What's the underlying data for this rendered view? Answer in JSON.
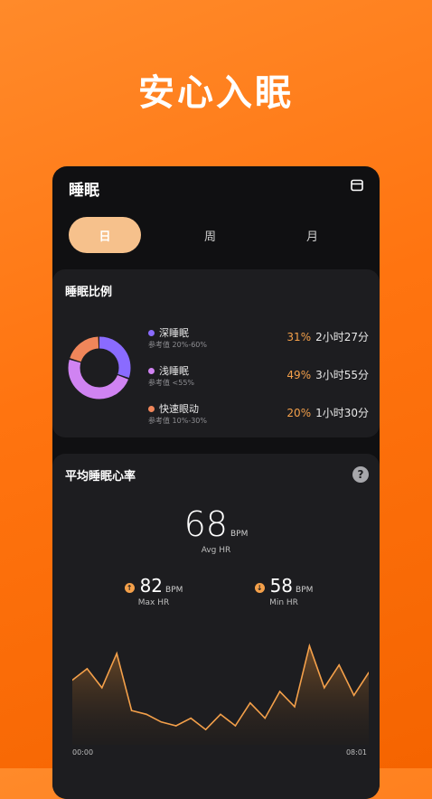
{
  "headline": "安心入眠",
  "header": {
    "title": "睡眠"
  },
  "tabs": [
    {
      "label": "日"
    },
    {
      "label": "周"
    },
    {
      "label": "月"
    }
  ],
  "ratio_card": {
    "title": "睡眠比例",
    "items": [
      {
        "name": "深睡眠",
        "ref": "参考值 20%-60%",
        "percent": "31%",
        "duration": "2小时27分",
        "color": "#8a6bff",
        "value": 31
      },
      {
        "name": "浅睡眠",
        "ref": "参考值 <55%",
        "percent": "49%",
        "duration": "3小时55分",
        "color": "#d083f2",
        "value": 49
      },
      {
        "name": "快速眼动",
        "ref": "参考值 10%-30%",
        "percent": "20%",
        "duration": "1小时30分",
        "color": "#f0865a",
        "value": 20
      }
    ]
  },
  "hr_card": {
    "title": "平均睡眠心率",
    "help": "?",
    "avg": {
      "value": "68",
      "unit": "BPM",
      "label": "Avg HR"
    },
    "max": {
      "value": "82",
      "unit": "BPM",
      "label": "Max HR",
      "arrow": "↑"
    },
    "min": {
      "value": "58",
      "unit": "BPM",
      "label": "Min HR",
      "arrow": "↓"
    },
    "time_start": "00:00",
    "time_end": "08:01"
  },
  "colors": {
    "accent": "#f4a04a",
    "card": "#1d1d20",
    "phone": "#101012"
  },
  "chart_data": {
    "type": "area",
    "x": [
      0,
      1,
      2,
      3,
      4,
      5,
      6,
      7,
      8,
      9,
      10,
      11,
      12,
      13,
      14,
      15,
      16,
      17,
      18,
      19,
      20
    ],
    "values": [
      72,
      75,
      70,
      79,
      64,
      63,
      61,
      60,
      62,
      59,
      63,
      60,
      66,
      62,
      69,
      65,
      81,
      70,
      76,
      68,
      74
    ],
    "ylim": [
      55,
      84
    ],
    "xlabel": "",
    "ylabel": ""
  }
}
